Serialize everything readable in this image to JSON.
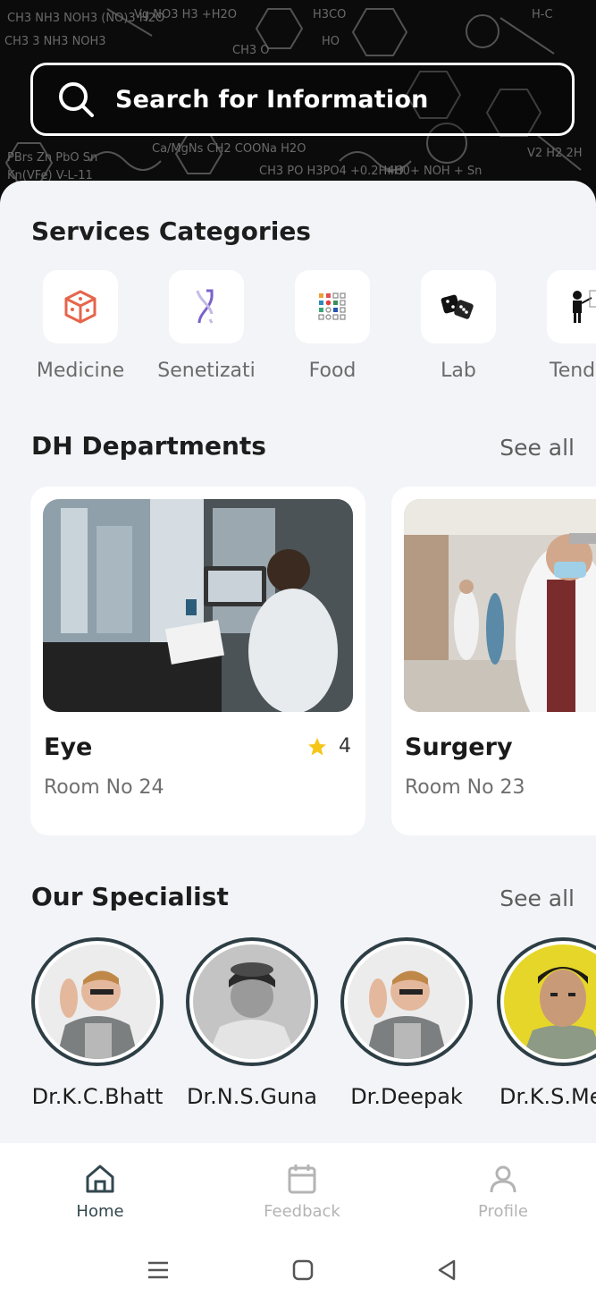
{
  "search": {
    "placeholder": "Search for Information"
  },
  "services": {
    "title": "Services Categories",
    "items": [
      {
        "label": "Medicine",
        "icon": "dice-outline-icon"
      },
      {
        "label": "Senetizati",
        "icon": "molecule-icon"
      },
      {
        "label": "Food",
        "icon": "grid-dots-icon"
      },
      {
        "label": "Lab",
        "icon": "dice-black-icon"
      },
      {
        "label": "Tend",
        "icon": "teacher-board-icon"
      }
    ]
  },
  "departments": {
    "title": "DH Departments",
    "see_all": "See all",
    "cards": [
      {
        "name": "Eye",
        "room": "Room No 24",
        "rating": "4"
      },
      {
        "name": "Surgery",
        "room": "Room No 23"
      }
    ]
  },
  "specialists": {
    "title": "Our Specialist",
    "see_all": "See all",
    "doctors": [
      {
        "name": "Dr.K.C.Bhatt"
      },
      {
        "name": "Dr.N.S.Guna"
      },
      {
        "name": "Dr.Deepak"
      },
      {
        "name": "Dr.K.S.Me"
      }
    ]
  },
  "nav": {
    "home": "Home",
    "feedback": "Feedback",
    "profile": "Profile"
  },
  "colors": {
    "accent": "#33474f",
    "star": "#f5c518",
    "background": "#f3f4f8"
  }
}
